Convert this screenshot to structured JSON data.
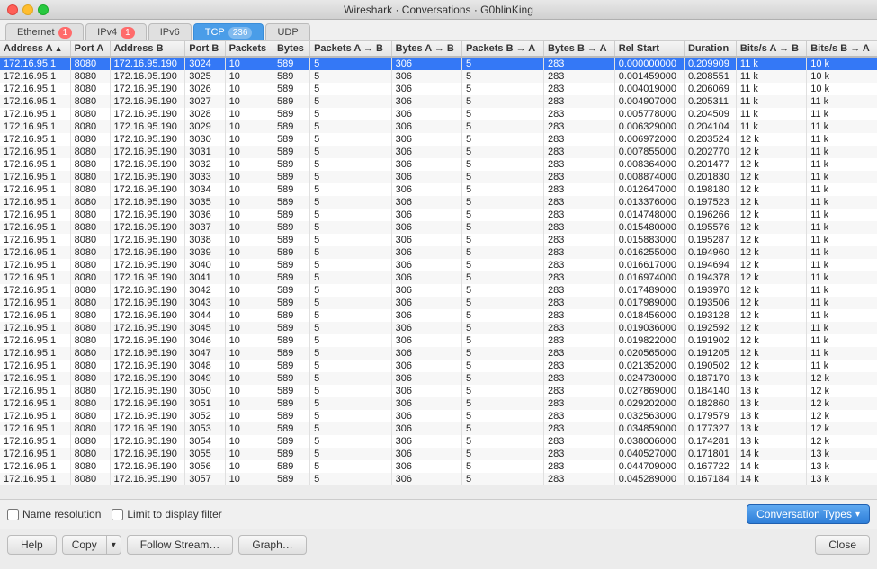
{
  "window": {
    "title": "Wireshark · Conversations · G0blinKing"
  },
  "tabs": [
    {
      "label": "Ethernet",
      "badge": "1",
      "active": false
    },
    {
      "label": "IPv4",
      "badge": "1",
      "active": false
    },
    {
      "label": "IPv6",
      "badge": null,
      "active": false
    },
    {
      "label": "TCP",
      "badge": "236",
      "active": true
    },
    {
      "label": "UDP",
      "badge": null,
      "active": false
    }
  ],
  "columns": [
    {
      "label": "Address A",
      "sortable": true,
      "sort": "asc"
    },
    {
      "label": "Port A",
      "sortable": false
    },
    {
      "label": "Address B",
      "sortable": false
    },
    {
      "label": "Port B",
      "sortable": false
    },
    {
      "label": "Packets",
      "sortable": false
    },
    {
      "label": "Bytes",
      "sortable": false
    },
    {
      "label": "Packets A → B",
      "sortable": false
    },
    {
      "label": "Bytes A → B",
      "sortable": false
    },
    {
      "label": "Packets B → A",
      "sortable": false
    },
    {
      "label": "Bytes B → A",
      "sortable": false
    },
    {
      "label": "Rel Start",
      "sortable": false
    },
    {
      "label": "Duration",
      "sortable": false
    },
    {
      "label": "Bits/s A → B",
      "sortable": false
    },
    {
      "label": "Bits/s B → A",
      "sortable": false
    }
  ],
  "rows": [
    {
      "addr_a": "172.16.95.1",
      "port_a": "8080",
      "addr_b": "172.16.95.190",
      "port_b": "3024",
      "packets": "10",
      "bytes": "589",
      "pkt_ab": "5",
      "bytes_ab": "306",
      "pkt_ba": "5",
      "bytes_ba": "283",
      "rel_start": "0.000000000",
      "duration": "0.209909",
      "bits_ab": "11 k",
      "bits_ba": "10 k",
      "selected": true
    },
    {
      "addr_a": "172.16.95.1",
      "port_a": "8080",
      "addr_b": "172.16.95.190",
      "port_b": "3025",
      "packets": "10",
      "bytes": "589",
      "pkt_ab": "5",
      "bytes_ab": "306",
      "pkt_ba": "5",
      "bytes_ba": "283",
      "rel_start": "0.001459000",
      "duration": "0.208551",
      "bits_ab": "11 k",
      "bits_ba": "10 k",
      "selected": false
    },
    {
      "addr_a": "172.16.95.1",
      "port_a": "8080",
      "addr_b": "172.16.95.190",
      "port_b": "3026",
      "packets": "10",
      "bytes": "589",
      "pkt_ab": "5",
      "bytes_ab": "306",
      "pkt_ba": "5",
      "bytes_ba": "283",
      "rel_start": "0.004019000",
      "duration": "0.206069",
      "bits_ab": "11 k",
      "bits_ba": "10 k",
      "selected": false
    },
    {
      "addr_a": "172.16.95.1",
      "port_a": "8080",
      "addr_b": "172.16.95.190",
      "port_b": "3027",
      "packets": "10",
      "bytes": "589",
      "pkt_ab": "5",
      "bytes_ab": "306",
      "pkt_ba": "5",
      "bytes_ba": "283",
      "rel_start": "0.004907000",
      "duration": "0.205311",
      "bits_ab": "11 k",
      "bits_ba": "11 k",
      "selected": false
    },
    {
      "addr_a": "172.16.95.1",
      "port_a": "8080",
      "addr_b": "172.16.95.190",
      "port_b": "3028",
      "packets": "10",
      "bytes": "589",
      "pkt_ab": "5",
      "bytes_ab": "306",
      "pkt_ba": "5",
      "bytes_ba": "283",
      "rel_start": "0.005778000",
      "duration": "0.204509",
      "bits_ab": "11 k",
      "bits_ba": "11 k",
      "selected": false
    },
    {
      "addr_a": "172.16.95.1",
      "port_a": "8080",
      "addr_b": "172.16.95.190",
      "port_b": "3029",
      "packets": "10",
      "bytes": "589",
      "pkt_ab": "5",
      "bytes_ab": "306",
      "pkt_ba": "5",
      "bytes_ba": "283",
      "rel_start": "0.006329000",
      "duration": "0.204104",
      "bits_ab": "11 k",
      "bits_ba": "11 k",
      "selected": false
    },
    {
      "addr_a": "172.16.95.1",
      "port_a": "8080",
      "addr_b": "172.16.95.190",
      "port_b": "3030",
      "packets": "10",
      "bytes": "589",
      "pkt_ab": "5",
      "bytes_ab": "306",
      "pkt_ba": "5",
      "bytes_ba": "283",
      "rel_start": "0.006972000",
      "duration": "0.203524",
      "bits_ab": "12 k",
      "bits_ba": "11 k",
      "selected": false
    },
    {
      "addr_a": "172.16.95.1",
      "port_a": "8080",
      "addr_b": "172.16.95.190",
      "port_b": "3031",
      "packets": "10",
      "bytes": "589",
      "pkt_ab": "5",
      "bytes_ab": "306",
      "pkt_ba": "5",
      "bytes_ba": "283",
      "rel_start": "0.007855000",
      "duration": "0.202770",
      "bits_ab": "12 k",
      "bits_ba": "11 k",
      "selected": false
    },
    {
      "addr_a": "172.16.95.1",
      "port_a": "8080",
      "addr_b": "172.16.95.190",
      "port_b": "3032",
      "packets": "10",
      "bytes": "589",
      "pkt_ab": "5",
      "bytes_ab": "306",
      "pkt_ba": "5",
      "bytes_ba": "283",
      "rel_start": "0.008364000",
      "duration": "0.201477",
      "bits_ab": "12 k",
      "bits_ba": "11 k",
      "selected": false
    },
    {
      "addr_a": "172.16.95.1",
      "port_a": "8080",
      "addr_b": "172.16.95.190",
      "port_b": "3033",
      "packets": "10",
      "bytes": "589",
      "pkt_ab": "5",
      "bytes_ab": "306",
      "pkt_ba": "5",
      "bytes_ba": "283",
      "rel_start": "0.008874000",
      "duration": "0.201830",
      "bits_ab": "12 k",
      "bits_ba": "11 k",
      "selected": false
    },
    {
      "addr_a": "172.16.95.1",
      "port_a": "8080",
      "addr_b": "172.16.95.190",
      "port_b": "3034",
      "packets": "10",
      "bytes": "589",
      "pkt_ab": "5",
      "bytes_ab": "306",
      "pkt_ba": "5",
      "bytes_ba": "283",
      "rel_start": "0.012647000",
      "duration": "0.198180",
      "bits_ab": "12 k",
      "bits_ba": "11 k",
      "selected": false
    },
    {
      "addr_a": "172.16.95.1",
      "port_a": "8080",
      "addr_b": "172.16.95.190",
      "port_b": "3035",
      "packets": "10",
      "bytes": "589",
      "pkt_ab": "5",
      "bytes_ab": "306",
      "pkt_ba": "5",
      "bytes_ba": "283",
      "rel_start": "0.013376000",
      "duration": "0.197523",
      "bits_ab": "12 k",
      "bits_ba": "11 k",
      "selected": false
    },
    {
      "addr_a": "172.16.95.1",
      "port_a": "8080",
      "addr_b": "172.16.95.190",
      "port_b": "3036",
      "packets": "10",
      "bytes": "589",
      "pkt_ab": "5",
      "bytes_ab": "306",
      "pkt_ba": "5",
      "bytes_ba": "283",
      "rel_start": "0.014748000",
      "duration": "0.196266",
      "bits_ab": "12 k",
      "bits_ba": "11 k",
      "selected": false
    },
    {
      "addr_a": "172.16.95.1",
      "port_a": "8080",
      "addr_b": "172.16.95.190",
      "port_b": "3037",
      "packets": "10",
      "bytes": "589",
      "pkt_ab": "5",
      "bytes_ab": "306",
      "pkt_ba": "5",
      "bytes_ba": "283",
      "rel_start": "0.015480000",
      "duration": "0.195576",
      "bits_ab": "12 k",
      "bits_ba": "11 k",
      "selected": false
    },
    {
      "addr_a": "172.16.95.1",
      "port_a": "8080",
      "addr_b": "172.16.95.190",
      "port_b": "3038",
      "packets": "10",
      "bytes": "589",
      "pkt_ab": "5",
      "bytes_ab": "306",
      "pkt_ba": "5",
      "bytes_ba": "283",
      "rel_start": "0.015883000",
      "duration": "0.195287",
      "bits_ab": "12 k",
      "bits_ba": "11 k",
      "selected": false
    },
    {
      "addr_a": "172.16.95.1",
      "port_a": "8080",
      "addr_b": "172.16.95.190",
      "port_b": "3039",
      "packets": "10",
      "bytes": "589",
      "pkt_ab": "5",
      "bytes_ab": "306",
      "pkt_ba": "5",
      "bytes_ba": "283",
      "rel_start": "0.016255000",
      "duration": "0.194960",
      "bits_ab": "12 k",
      "bits_ba": "11 k",
      "selected": false
    },
    {
      "addr_a": "172.16.95.1",
      "port_a": "8080",
      "addr_b": "172.16.95.190",
      "port_b": "3040",
      "packets": "10",
      "bytes": "589",
      "pkt_ab": "5",
      "bytes_ab": "306",
      "pkt_ba": "5",
      "bytes_ba": "283",
      "rel_start": "0.016617000",
      "duration": "0.194694",
      "bits_ab": "12 k",
      "bits_ba": "11 k",
      "selected": false
    },
    {
      "addr_a": "172.16.95.1",
      "port_a": "8080",
      "addr_b": "172.16.95.190",
      "port_b": "3041",
      "packets": "10",
      "bytes": "589",
      "pkt_ab": "5",
      "bytes_ab": "306",
      "pkt_ba": "5",
      "bytes_ba": "283",
      "rel_start": "0.016974000",
      "duration": "0.194378",
      "bits_ab": "12 k",
      "bits_ba": "11 k",
      "selected": false
    },
    {
      "addr_a": "172.16.95.1",
      "port_a": "8080",
      "addr_b": "172.16.95.190",
      "port_b": "3042",
      "packets": "10",
      "bytes": "589",
      "pkt_ab": "5",
      "bytes_ab": "306",
      "pkt_ba": "5",
      "bytes_ba": "283",
      "rel_start": "0.017489000",
      "duration": "0.193970",
      "bits_ab": "12 k",
      "bits_ba": "11 k",
      "selected": false
    },
    {
      "addr_a": "172.16.95.1",
      "port_a": "8080",
      "addr_b": "172.16.95.190",
      "port_b": "3043",
      "packets": "10",
      "bytes": "589",
      "pkt_ab": "5",
      "bytes_ab": "306",
      "pkt_ba": "5",
      "bytes_ba": "283",
      "rel_start": "0.017989000",
      "duration": "0.193506",
      "bits_ab": "12 k",
      "bits_ba": "11 k",
      "selected": false
    },
    {
      "addr_a": "172.16.95.1",
      "port_a": "8080",
      "addr_b": "172.16.95.190",
      "port_b": "3044",
      "packets": "10",
      "bytes": "589",
      "pkt_ab": "5",
      "bytes_ab": "306",
      "pkt_ba": "5",
      "bytes_ba": "283",
      "rel_start": "0.018456000",
      "duration": "0.193128",
      "bits_ab": "12 k",
      "bits_ba": "11 k",
      "selected": false
    },
    {
      "addr_a": "172.16.95.1",
      "port_a": "8080",
      "addr_b": "172.16.95.190",
      "port_b": "3045",
      "packets": "10",
      "bytes": "589",
      "pkt_ab": "5",
      "bytes_ab": "306",
      "pkt_ba": "5",
      "bytes_ba": "283",
      "rel_start": "0.019036000",
      "duration": "0.192592",
      "bits_ab": "12 k",
      "bits_ba": "11 k",
      "selected": false
    },
    {
      "addr_a": "172.16.95.1",
      "port_a": "8080",
      "addr_b": "172.16.95.190",
      "port_b": "3046",
      "packets": "10",
      "bytes": "589",
      "pkt_ab": "5",
      "bytes_ab": "306",
      "pkt_ba": "5",
      "bytes_ba": "283",
      "rel_start": "0.019822000",
      "duration": "0.191902",
      "bits_ab": "12 k",
      "bits_ba": "11 k",
      "selected": false
    },
    {
      "addr_a": "172.16.95.1",
      "port_a": "8080",
      "addr_b": "172.16.95.190",
      "port_b": "3047",
      "packets": "10",
      "bytes": "589",
      "pkt_ab": "5",
      "bytes_ab": "306",
      "pkt_ba": "5",
      "bytes_ba": "283",
      "rel_start": "0.020565000",
      "duration": "0.191205",
      "bits_ab": "12 k",
      "bits_ba": "11 k",
      "selected": false
    },
    {
      "addr_a": "172.16.95.1",
      "port_a": "8080",
      "addr_b": "172.16.95.190",
      "port_b": "3048",
      "packets": "10",
      "bytes": "589",
      "pkt_ab": "5",
      "bytes_ab": "306",
      "pkt_ba": "5",
      "bytes_ba": "283",
      "rel_start": "0.021352000",
      "duration": "0.190502",
      "bits_ab": "12 k",
      "bits_ba": "11 k",
      "selected": false
    },
    {
      "addr_a": "172.16.95.1",
      "port_a": "8080",
      "addr_b": "172.16.95.190",
      "port_b": "3049",
      "packets": "10",
      "bytes": "589",
      "pkt_ab": "5",
      "bytes_ab": "306",
      "pkt_ba": "5",
      "bytes_ba": "283",
      "rel_start": "0.024730000",
      "duration": "0.187170",
      "bits_ab": "13 k",
      "bits_ba": "12 k",
      "selected": false
    },
    {
      "addr_a": "172.16.95.1",
      "port_a": "8080",
      "addr_b": "172.16.95.190",
      "port_b": "3050",
      "packets": "10",
      "bytes": "589",
      "pkt_ab": "5",
      "bytes_ab": "306",
      "pkt_ba": "5",
      "bytes_ba": "283",
      "rel_start": "0.027869000",
      "duration": "0.184140",
      "bits_ab": "13 k",
      "bits_ba": "12 k",
      "selected": false
    },
    {
      "addr_a": "172.16.95.1",
      "port_a": "8080",
      "addr_b": "172.16.95.190",
      "port_b": "3051",
      "packets": "10",
      "bytes": "589",
      "pkt_ab": "5",
      "bytes_ab": "306",
      "pkt_ba": "5",
      "bytes_ba": "283",
      "rel_start": "0.029202000",
      "duration": "0.182860",
      "bits_ab": "13 k",
      "bits_ba": "12 k",
      "selected": false
    },
    {
      "addr_a": "172.16.95.1",
      "port_a": "8080",
      "addr_b": "172.16.95.190",
      "port_b": "3052",
      "packets": "10",
      "bytes": "589",
      "pkt_ab": "5",
      "bytes_ab": "306",
      "pkt_ba": "5",
      "bytes_ba": "283",
      "rel_start": "0.032563000",
      "duration": "0.179579",
      "bits_ab": "13 k",
      "bits_ba": "12 k",
      "selected": false
    },
    {
      "addr_a": "172.16.95.1",
      "port_a": "8080",
      "addr_b": "172.16.95.190",
      "port_b": "3053",
      "packets": "10",
      "bytes": "589",
      "pkt_ab": "5",
      "bytes_ab": "306",
      "pkt_ba": "5",
      "bytes_ba": "283",
      "rel_start": "0.034859000",
      "duration": "0.177327",
      "bits_ab": "13 k",
      "bits_ba": "12 k",
      "selected": false
    },
    {
      "addr_a": "172.16.95.1",
      "port_a": "8080",
      "addr_b": "172.16.95.190",
      "port_b": "3054",
      "packets": "10",
      "bytes": "589",
      "pkt_ab": "5",
      "bytes_ab": "306",
      "pkt_ba": "5",
      "bytes_ba": "283",
      "rel_start": "0.038006000",
      "duration": "0.174281",
      "bits_ab": "13 k",
      "bits_ba": "12 k",
      "selected": false
    },
    {
      "addr_a": "172.16.95.1",
      "port_a": "8080",
      "addr_b": "172.16.95.190",
      "port_b": "3055",
      "packets": "10",
      "bytes": "589",
      "pkt_ab": "5",
      "bytes_ab": "306",
      "pkt_ba": "5",
      "bytes_ba": "283",
      "rel_start": "0.040527000",
      "duration": "0.171801",
      "bits_ab": "14 k",
      "bits_ba": "13 k",
      "selected": false
    },
    {
      "addr_a": "172.16.95.1",
      "port_a": "8080",
      "addr_b": "172.16.95.190",
      "port_b": "3056",
      "packets": "10",
      "bytes": "589",
      "pkt_ab": "5",
      "bytes_ab": "306",
      "pkt_ba": "5",
      "bytes_ba": "283",
      "rel_start": "0.044709000",
      "duration": "0.167722",
      "bits_ab": "14 k",
      "bits_ba": "13 k",
      "selected": false
    },
    {
      "addr_a": "172.16.95.1",
      "port_a": "8080",
      "addr_b": "172.16.95.190",
      "port_b": "3057",
      "packets": "10",
      "bytes": "589",
      "pkt_ab": "5",
      "bytes_ab": "306",
      "pkt_ba": "5",
      "bytes_ba": "283",
      "rel_start": "0.045289000",
      "duration": "0.167184",
      "bits_ab": "14 k",
      "bits_ba": "13 k",
      "selected": false
    }
  ],
  "bottom_bar": {
    "name_resolution_label": "Name resolution",
    "limit_display_label": "Limit to display filter",
    "conv_types_label": "Conversation Types"
  },
  "footer": {
    "help_label": "Help",
    "copy_label": "Copy",
    "follow_stream_label": "Follow Stream…",
    "graph_label": "Graph…",
    "close_label": "Close"
  }
}
